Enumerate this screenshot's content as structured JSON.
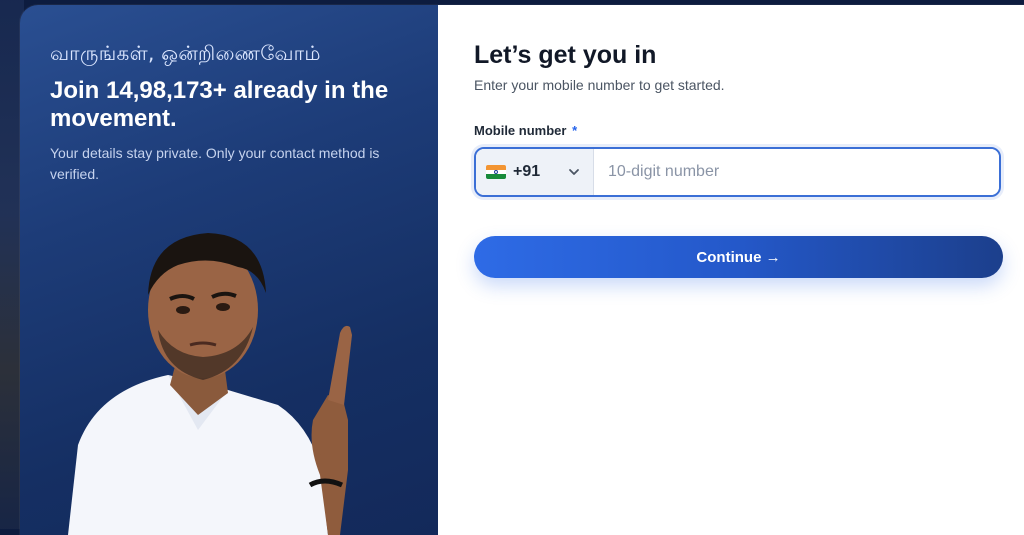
{
  "hero": {
    "tamil_greeting": "வாருங்கள், ஒன்றிணைவோம்",
    "headline": "Join 14,98,173+ already in the movement.",
    "subtext": "Your details stay private. Only your contact method is verified."
  },
  "form": {
    "title": "Let’s get you in",
    "lead": "Enter your mobile number to get started.",
    "mobile_label": "Mobile number",
    "required_mark": "*",
    "country_code": "+91",
    "country_flag": "india-flag-icon",
    "phone_placeholder": "10-digit number",
    "phone_value": "",
    "continue_label": "Continue →"
  },
  "colors": {
    "panel_start": "#2a4f92",
    "panel_end": "#13295a",
    "accent": "#2e6be6",
    "accent_dark": "#1c3f8c",
    "required": "#2563eb"
  }
}
